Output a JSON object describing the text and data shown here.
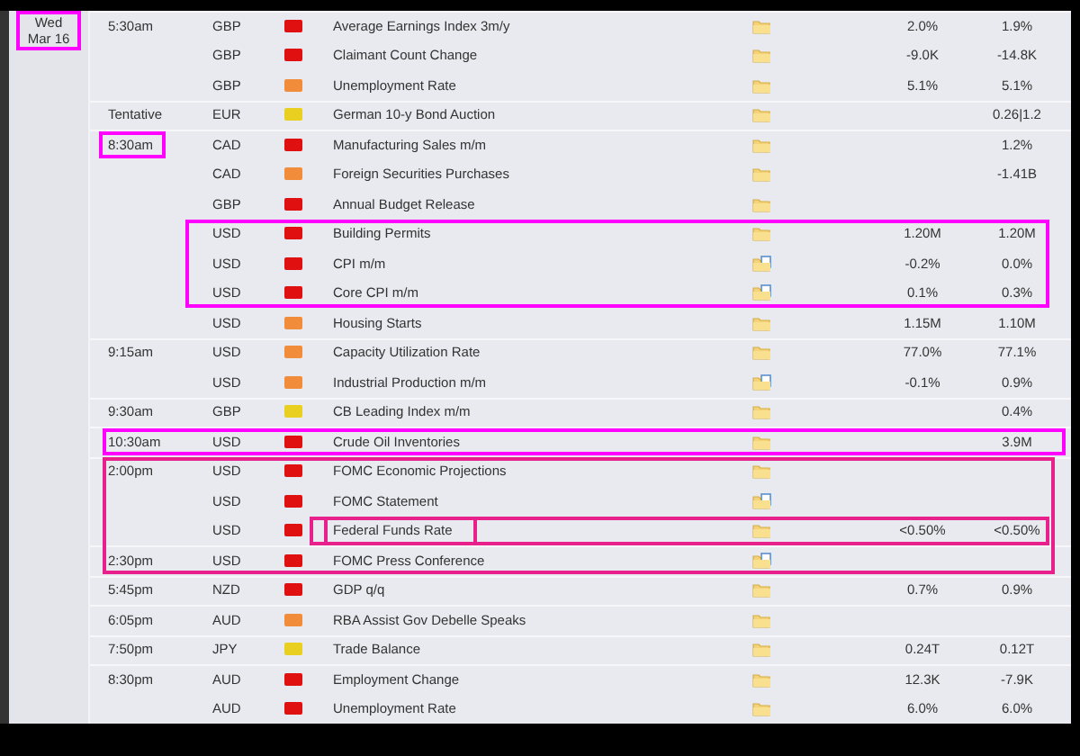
{
  "day": {
    "weekday": "Wed",
    "date": "Mar 16",
    "highlighted": true
  },
  "rows": [
    {
      "time": "5:30am",
      "currency": "GBP",
      "color": "#e01010",
      "event": "Average Earnings Index 3m/y",
      "kind": "folder",
      "column_7": "2.0%",
      "column_8": "1.9%"
    },
    {
      "currency": "GBP",
      "color": "#e01010",
      "event": "Claimant Count Change",
      "kind": "folder",
      "column_7": "-9.0K",
      "column_8": "-14.8K"
    },
    {
      "currency": "GBP",
      "color": "#f08c3a",
      "event": "Unemployment Rate",
      "kind": "folder",
      "column_7": "5.1%",
      "column_8": "5.1%"
    },
    {
      "time": "Tentative",
      "currency": "EUR",
      "color": "#e8cf20",
      "event": "German 10-y Bond Auction",
      "kind": "folder",
      "column_8": "0.26|1.2"
    },
    {
      "time": "8:30am",
      "currency": "CAD",
      "color": "#e01010",
      "event": "Manufacturing Sales m/m",
      "kind": "folder",
      "column_8": "1.2%",
      "highlights": [
        {
          "kind": "time"
        }
      ]
    },
    {
      "currency": "CAD",
      "color": "#f08c3a",
      "event": "Foreign Securities Purchases",
      "kind": "folder",
      "column_8": "-1.41B"
    },
    {
      "currency": "GBP",
      "color": "#e01010",
      "event": "Annual Budget Release",
      "kind": "folder"
    },
    {
      "currency": "USD",
      "color": "#e01010",
      "event": "Building Permits",
      "kind": "folder",
      "column_7": "1.20M",
      "column_8": "1.20M",
      "highlights": [
        {
          "kind": "block-top"
        }
      ]
    },
    {
      "currency": "USD",
      "color": "#e01010",
      "event": "CPI m/m",
      "kind": "folder-page",
      "column_7": "-0.2%",
      "column_8": "0.0%"
    },
    {
      "currency": "USD",
      "color": "#e01010",
      "event": "Core CPI m/m",
      "kind": "folder-page",
      "column_7": "0.1%",
      "column_8": "0.3%",
      "highlights": [
        {
          "kind": "block-bottom"
        }
      ]
    },
    {
      "currency": "USD",
      "color": "#f08c3a",
      "event": "Housing Starts",
      "kind": "folder",
      "column_7": "1.15M",
      "column_8": "1.10M"
    },
    {
      "time": "9:15am",
      "currency": "USD",
      "color": "#f08c3a",
      "event": "Capacity Utilization Rate",
      "kind": "folder",
      "column_7": "77.0%",
      "column_8": "77.1%"
    },
    {
      "currency": "USD",
      "color": "#f08c3a",
      "event": "Industrial Production m/m",
      "kind": "folder-page",
      "column_7": "-0.1%",
      "column_8": "0.9%"
    },
    {
      "time": "9:30am",
      "currency": "GBP",
      "color": "#e8cf20",
      "event": "CB Leading Index m/m",
      "kind": "folder",
      "column_8": "0.4%"
    },
    {
      "time": "10:30am",
      "currency": "USD",
      "color": "#e01010",
      "event": "Crude Oil Inventories",
      "kind": "folder",
      "column_8": "3.9M",
      "highlights": [
        {
          "kind": "row"
        }
      ]
    },
    {
      "time": "2:00pm",
      "currency": "USD",
      "color": "#e01010",
      "event": "FOMC Economic Projections",
      "kind": "folder",
      "highlights": [
        {
          "kind": "group-top"
        }
      ]
    },
    {
      "currency": "USD",
      "color": "#e01010",
      "event": "FOMC Statement",
      "kind": "folder-page"
    },
    {
      "currency": "USD",
      "color": "#e01010",
      "event": "Federal Funds Rate",
      "kind": "folder",
      "column_7": "<0.50%",
      "column_8": "<0.50%",
      "highlights": [
        {
          "kind": "name"
        },
        {
          "kind": "name-to-end"
        }
      ]
    },
    {
      "time": "2:30pm",
      "currency": "USD",
      "color": "#e01010",
      "event": "FOMC Press Conference",
      "kind": "folder-page",
      "highlights": [
        {
          "kind": "group-bottom"
        }
      ]
    },
    {
      "time": "5:45pm",
      "currency": "NZD",
      "color": "#e01010",
      "event": "GDP q/q",
      "kind": "folder",
      "column_7": "0.7%",
      "column_8": "0.9%"
    },
    {
      "time": "6:05pm",
      "currency": "AUD",
      "color": "#f08c3a",
      "event": "RBA Assist Gov Debelle Speaks",
      "kind": "folder"
    },
    {
      "time": "7:50pm",
      "currency": "JPY",
      "color": "#e8cf20",
      "event": "Trade Balance",
      "kind": "folder",
      "column_7": "0.24T",
      "column_8": "0.12T"
    },
    {
      "time": "8:30pm",
      "currency": "AUD",
      "color": "#e01010",
      "event": "Employment Change",
      "kind": "folder",
      "column_7": "12.3K",
      "column_8": "-7.9K"
    },
    {
      "currency": "AUD",
      "color": "#e01010",
      "event": "Unemployment Rate",
      "kind": "folder",
      "column_7": "6.0%",
      "column_8": "6.0%"
    }
  ]
}
